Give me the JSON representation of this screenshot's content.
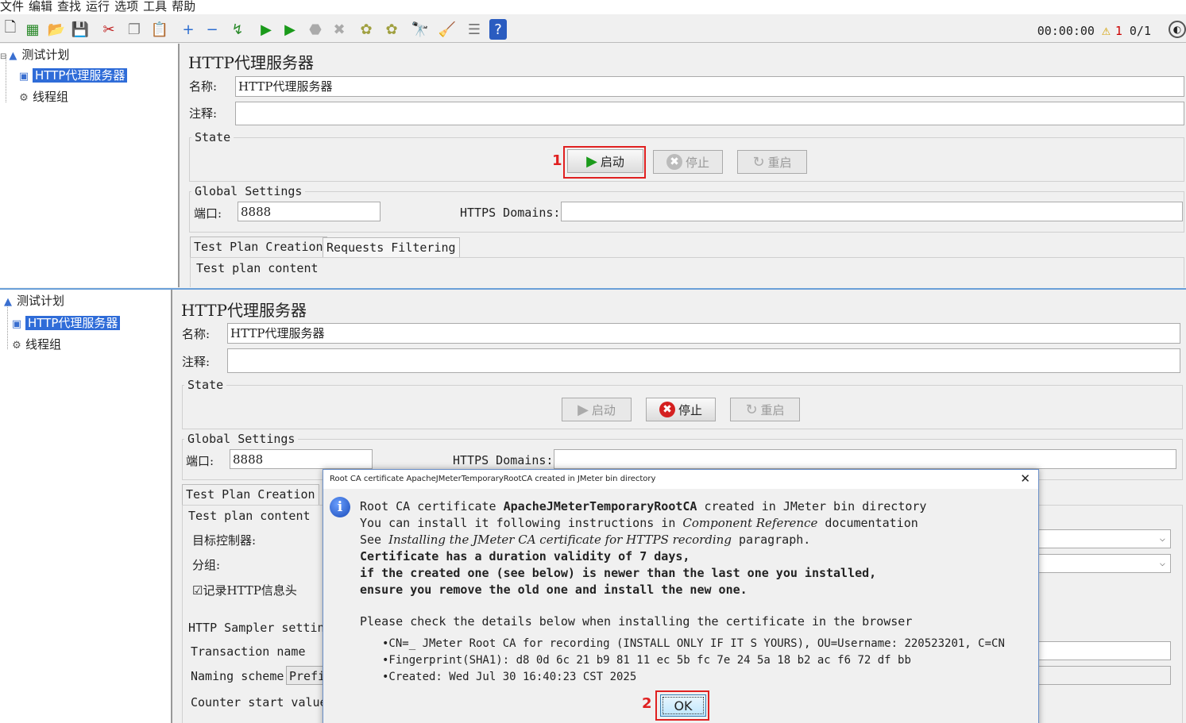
{
  "menu": [
    "文件",
    "编辑",
    "查找",
    "运行",
    "选项",
    "工具",
    "帮助"
  ],
  "status": {
    "timer": "00:00:00",
    "warnings": "1",
    "threads": "0/1"
  },
  "tree": {
    "plan": "测试计划",
    "proxy": "HTTP代理服务器",
    "thread_group": "线程组"
  },
  "panel": {
    "title": "HTTP代理服务器",
    "name_label": "名称:",
    "name_value": "HTTP代理服务器",
    "comment_label": "注释:",
    "state_label": "State",
    "start": "启动",
    "stop": "停止",
    "restart": "重启",
    "global_label": "Global Settings",
    "port_label": "端口:",
    "port_value": "8888",
    "https_label": "HTTPS Domains:",
    "tab_creation": "Test Plan Creation",
    "tab_filtering": "Requests Filtering",
    "plan_content": "Test plan content",
    "target_label": "目标控制器:",
    "group_label": "分组:",
    "record_headers": "☑记录HTTP信息头",
    "sampler_settings": "HTTP Sampler settin",
    "transaction_name": "Transaction name",
    "naming_scheme": "Naming scheme",
    "naming_value": "Prefi",
    "counter_start": "Counter start value"
  },
  "annotations": {
    "one": "1",
    "two": "2"
  },
  "dialog": {
    "title": "Root CA certificate ApacheJMeterTemporaryRootCA created in JMeter bin directory",
    "l1_a": "Root CA certificate ",
    "l1_b": "ApacheJMeterTemporaryRootCA",
    "l1_c": " created in JMeter bin directory",
    "l2_a": "You can install it following instructions in ",
    "l2_b": "Component Reference",
    "l2_c": " documentation",
    "l3_a": "See ",
    "l3_b": "Installing the JMeter CA certificate for HTTPS recording",
    "l3_c": " paragraph.",
    "l4": "Certificate has a duration validity of 7 days,",
    "l5": "if the created one (see below) is newer than the last one you installed,",
    "l6": "ensure you remove the old one and install the new one.",
    "l7": "Please check the details below when installing the certificate in the browser",
    "b1": "•CN=_ JMeter Root CA for recording (INSTALL ONLY IF IT S YOURS), OU=Username: 220523201, C=CN",
    "b2": "•Fingerprint(SHA1): d8 0d 6c 21 b9 81 11 ec 5b fc 7e 24 5a 18 b2 ac f6 72 df bb",
    "b3": "•Created: Wed Jul 30 16:40:23 CST 2025",
    "ok": "OK"
  },
  "colors": {
    "accent": "#2f6cd8",
    "highlight": "#e02020",
    "start_icon": "#1a9a1a",
    "stop_icon": "#d42020"
  }
}
